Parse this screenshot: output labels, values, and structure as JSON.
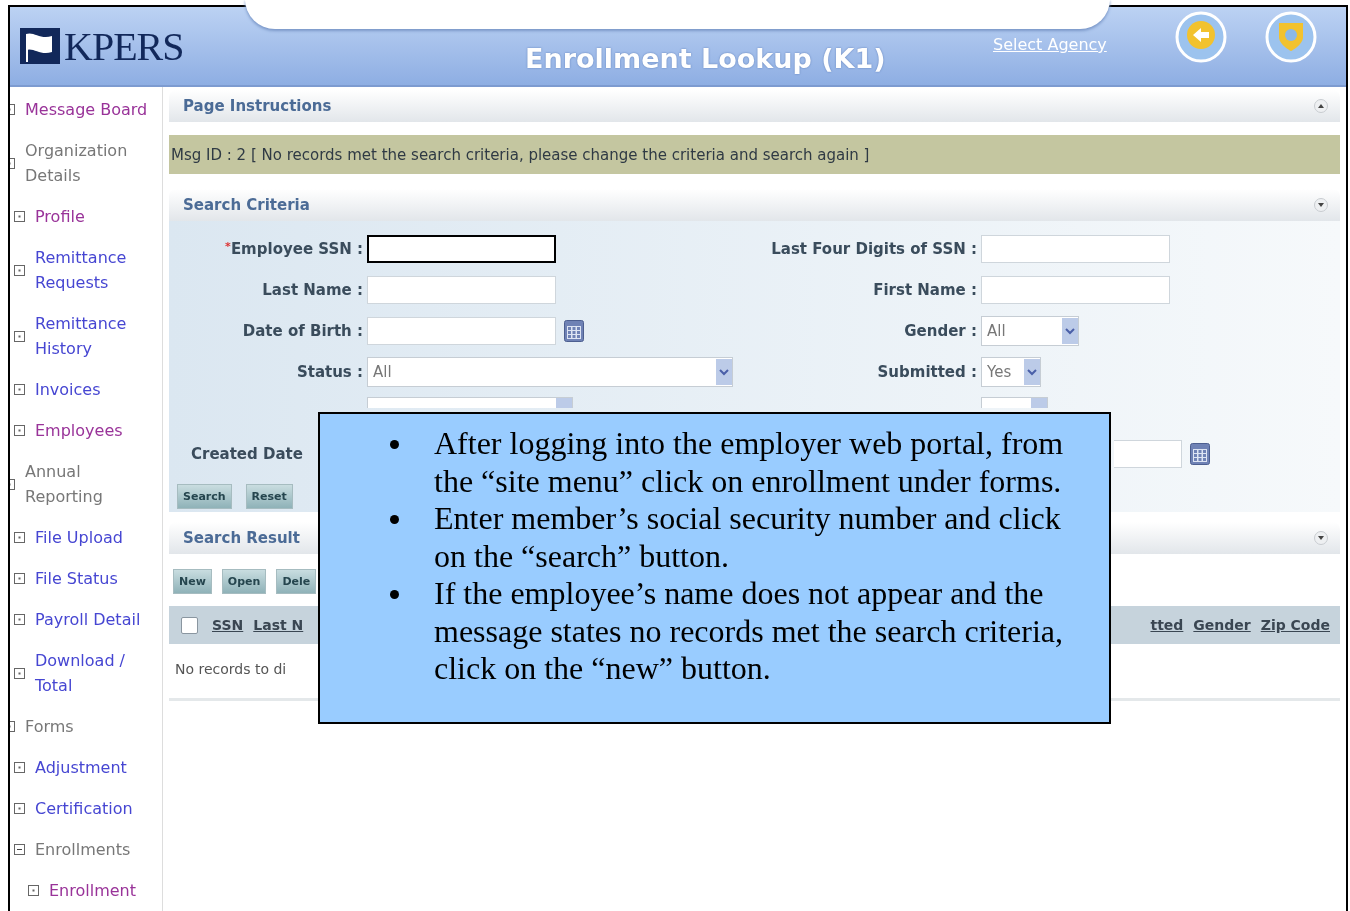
{
  "header": {
    "logo": "KPERS",
    "title": "Enrollment Lookup (K1)",
    "agency_link": "Select Agency"
  },
  "sidebar": {
    "items": [
      {
        "label": "Message Board",
        "kind": "link",
        "visited": true
      },
      {
        "label": "Organization Details",
        "kind": "group",
        "children": [
          {
            "label": "Profile",
            "kind": "link",
            "visited": true
          },
          {
            "label": "Remittance Requests",
            "kind": "link",
            "visited": false
          },
          {
            "label": "Remittance History",
            "kind": "link",
            "visited": false
          },
          {
            "label": "Invoices",
            "kind": "link",
            "visited": false
          },
          {
            "label": "Employees",
            "kind": "link",
            "visited": true
          }
        ]
      },
      {
        "label": "Annual Reporting",
        "kind": "group",
        "children": [
          {
            "label": "File Upload",
            "kind": "link",
            "visited": false
          },
          {
            "label": "File Status",
            "kind": "link",
            "visited": false
          },
          {
            "label": "Payroll Detail",
            "kind": "link",
            "visited": false
          },
          {
            "label": "Download / Total",
            "kind": "link",
            "visited": false
          }
        ]
      },
      {
        "label": "Forms",
        "kind": "group",
        "children": [
          {
            "label": "Adjustment",
            "kind": "link",
            "visited": false
          },
          {
            "label": "Certification",
            "kind": "link",
            "visited": false
          },
          {
            "label": "Enrollments",
            "kind": "group",
            "expanded": true,
            "children": [
              {
                "label": "Enrollment",
                "kind": "link",
                "visited": true
              }
            ]
          }
        ]
      }
    ]
  },
  "page_instructions": {
    "title": "Page Instructions",
    "expanded": false
  },
  "message": "Msg ID : 2 [ No records met the search criteria, please change the criteria and search again ]",
  "search_criteria": {
    "title": "Search Criteria",
    "expanded": true,
    "rows": [
      {
        "left": {
          "label": "Employee SSN :",
          "marker": "*",
          "kind": "text",
          "focused": true
        },
        "right": {
          "label": "Last Four Digits of SSN :",
          "kind": "text",
          "focused": false
        }
      },
      {
        "left": {
          "label": "Last Name :",
          "kind": "text",
          "focused": false
        },
        "right": {
          "label": "First Name :",
          "kind": "text",
          "focused": false
        }
      },
      {
        "left": {
          "label": "Date of Birth :",
          "kind": "date",
          "focused": false
        },
        "right": {
          "label": "Gender :",
          "kind": "select",
          "value": "All"
        }
      },
      {
        "left": {
          "label": "Status :",
          "kind": "select",
          "value": "All"
        },
        "right": {
          "label": "Submitted :",
          "kind": "select",
          "value": "Yes"
        }
      },
      {
        "left": {
          "kind": "select"
        },
        "right": {
          "kind": "select"
        }
      },
      {
        "left": {
          "label": "Created Date",
          "kind": "label"
        },
        "right": {
          "kind": "date",
          "focused": false
        }
      }
    ],
    "buttons": [
      "Search",
      "Reset"
    ]
  },
  "search_result": {
    "title": "Search Result",
    "expanded": true,
    "buttons": [
      "New",
      "Open",
      "Dele"
    ],
    "select_all_checked": false,
    "columns": [
      "SSN",
      "Last N",
      "tted",
      "Gender",
      "Zip Code"
    ],
    "empty_text": "No records to di"
  },
  "callout": {
    "bullets": [
      "After logging into the employer web portal, from the “site menu” click on enrollment under forms.",
      "Enter member’s social security number and click on the “search” button.",
      "If the employee’s name does not appear and the message states no records met the search criteria, click on the “new” button."
    ]
  }
}
